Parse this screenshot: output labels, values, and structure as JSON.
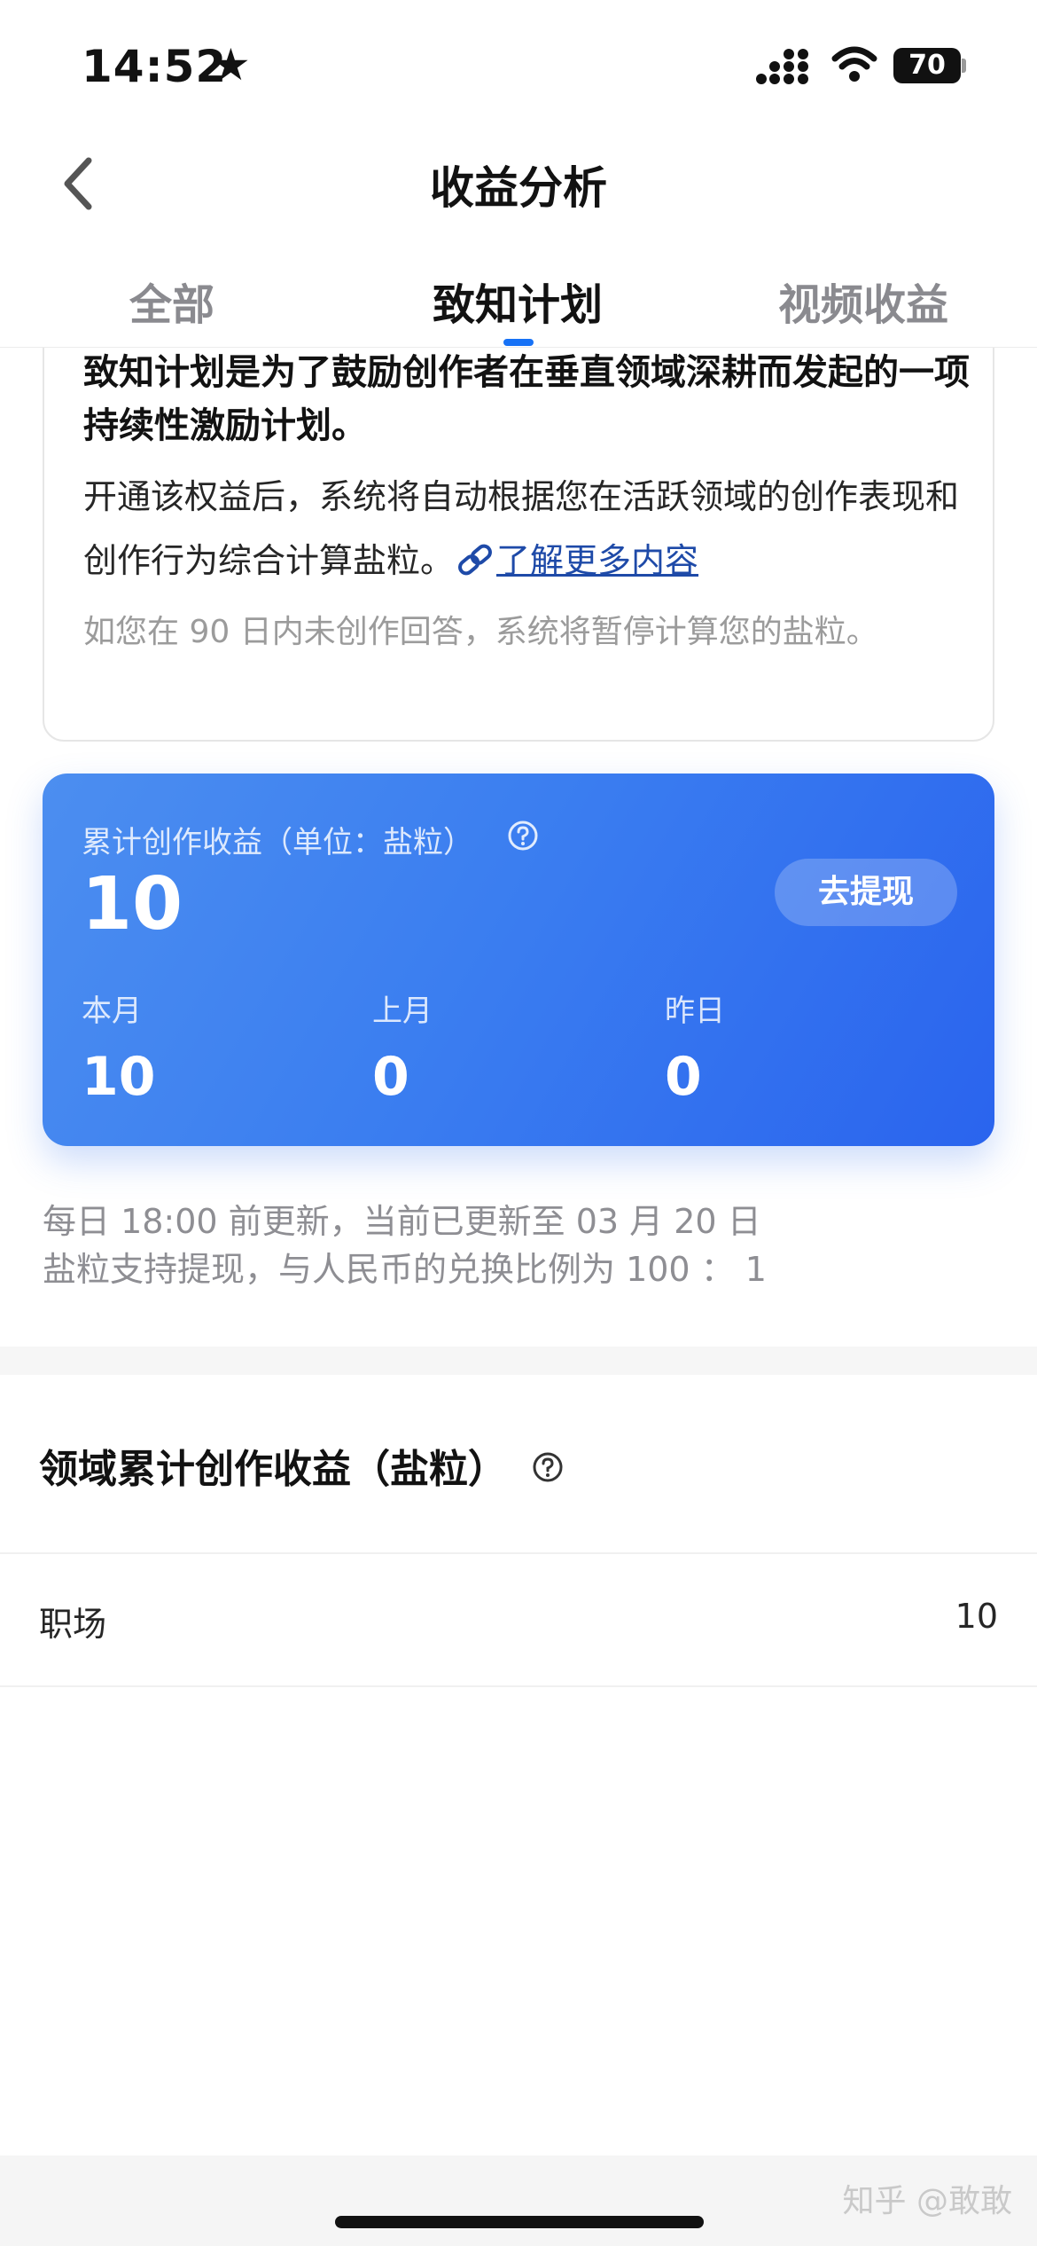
{
  "status_bar": {
    "time": "14:52",
    "star": "★",
    "battery": "70"
  },
  "nav": {
    "title": "收益分析"
  },
  "tabs": [
    {
      "label": "全部",
      "active": false
    },
    {
      "label": "致知计划",
      "active": true
    },
    {
      "label": "视频收益",
      "active": false
    }
  ],
  "intro": {
    "lead": "致知计划是为了鼓励创作者在垂直领域深耕而发起的一项持续性激励计划。",
    "body": "开通该权益后，系统将自动根据您在活跃领域的创作表现和创作行为综合计算盐粒。",
    "link": "了解更多内容",
    "note": "如您在 90 日内未创作回答，系统将暂停计算您的盐粒。"
  },
  "earnings": {
    "label": "累计创作收益（单位：盐粒）",
    "total": "10",
    "withdraw_label": "去提现",
    "stats": [
      {
        "label": "本月",
        "value": "10"
      },
      {
        "label": "上月",
        "value": "0"
      },
      {
        "label": "昨日",
        "value": "0"
      }
    ]
  },
  "update_info": {
    "line1": "每日 18:00 前更新，当前已更新至 03 月 20 日",
    "line2": "盐粒支持提现，与人民币的兑换比例为 100 ： 1"
  },
  "domain_section": {
    "title": "领域累计创作收益（盐粒）",
    "rows": [
      {
        "name": "职场",
        "value": "10"
      }
    ]
  },
  "watermark": "知乎 @敢敢",
  "colors": {
    "accent": "#1772f6",
    "card_start": "#4c8ef0",
    "card_end": "#2a64ee"
  }
}
